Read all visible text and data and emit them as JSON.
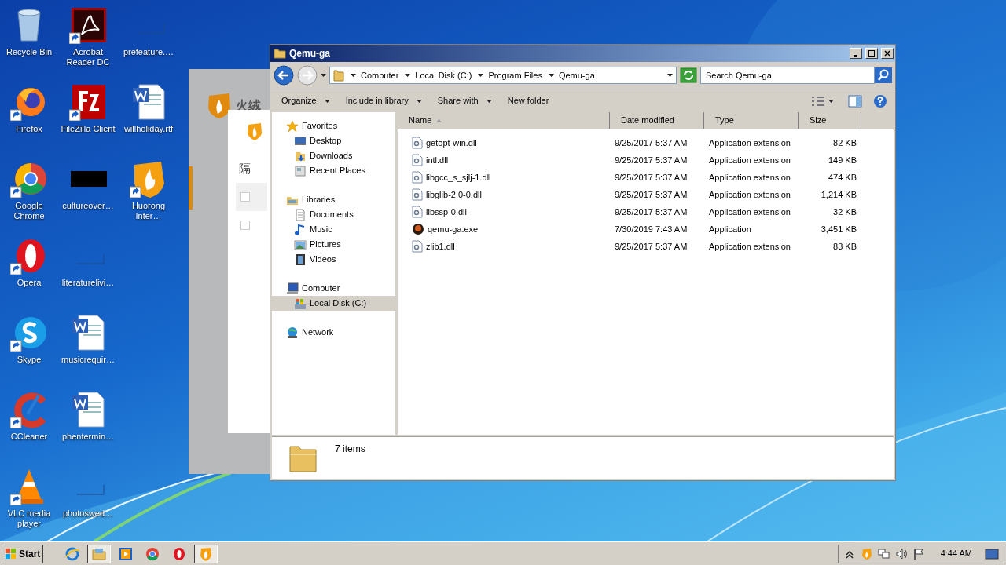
{
  "desktop_icons": [
    {
      "label": "Recycle Bin",
      "kind": "recycle",
      "shortcut": false
    },
    {
      "label": "Firefox",
      "kind": "firefox",
      "shortcut": true
    },
    {
      "label": "Google Chrome",
      "kind": "chrome",
      "shortcut": true
    },
    {
      "label": "Opera",
      "kind": "opera",
      "shortcut": true
    },
    {
      "label": "Skype",
      "kind": "skype",
      "shortcut": true
    },
    {
      "label": "CCleaner",
      "kind": "ccleaner",
      "shortcut": true
    },
    {
      "label": "VLC media player",
      "kind": "vlc",
      "shortcut": true
    },
    {
      "label": "Acrobat Reader DC",
      "kind": "acrobat",
      "shortcut": true
    },
    {
      "label": "FileZilla Client",
      "kind": "filezilla",
      "shortcut": true
    },
    {
      "label": "cultureover…",
      "kind": "black",
      "shortcut": false
    },
    {
      "label": "literaturelivi…",
      "kind": "blank",
      "shortcut": false
    },
    {
      "label": "musicrequir…",
      "kind": "word",
      "shortcut": false
    },
    {
      "label": "phentermin…",
      "kind": "word",
      "shortcut": false
    },
    {
      "label": "photoswed…",
      "kind": "blank",
      "shortcut": false
    },
    {
      "label": "prefeature.…",
      "kind": "blank",
      "shortcut": false
    },
    {
      "label": "willholiday.rtf",
      "kind": "word",
      "shortcut": false
    },
    {
      "label": "Huorong Inter…",
      "kind": "huorong",
      "shortcut": true
    }
  ],
  "background_window": {
    "title": "火绒",
    "heading": "隔",
    "checkboxes": [
      {
        "checked": false
      },
      {
        "checked": false
      }
    ]
  },
  "explorer": {
    "title": "Qemu-ga",
    "breadcrumb": [
      "Computer",
      "Local Disk (C:)",
      "Program Files",
      "Qemu-ga"
    ],
    "search": {
      "placeholder": "Search Qemu-ga"
    },
    "toolbar": [
      {
        "label": "Organize",
        "dropdown": true
      },
      {
        "label": "Include in library",
        "dropdown": true
      },
      {
        "label": "Share with",
        "dropdown": true
      },
      {
        "label": "New folder",
        "dropdown": false
      }
    ],
    "nav": [
      {
        "label": "Favorites",
        "kind": "star",
        "selected": false,
        "children": [
          {
            "label": "Desktop",
            "kind": "desktop",
            "selected": false
          },
          {
            "label": "Downloads",
            "kind": "downloads",
            "selected": false
          },
          {
            "label": "Recent Places",
            "kind": "recent",
            "selected": false
          }
        ]
      },
      {
        "label": "Libraries",
        "kind": "libraries",
        "selected": false,
        "children": [
          {
            "label": "Documents",
            "kind": "documents",
            "selected": false
          },
          {
            "label": "Music",
            "kind": "music",
            "selected": false
          },
          {
            "label": "Pictures",
            "kind": "pictures",
            "selected": false
          },
          {
            "label": "Videos",
            "kind": "videos",
            "selected": false
          }
        ]
      },
      {
        "label": "Computer",
        "kind": "computer",
        "selected": false,
        "children": [
          {
            "label": "Local Disk (C:)",
            "kind": "disk",
            "selected": true
          }
        ]
      },
      {
        "label": "Network",
        "kind": "network",
        "selected": false
      }
    ],
    "columns": [
      {
        "label": "Name",
        "sorted": true
      },
      {
        "label": "Date modified",
        "sorted": false
      },
      {
        "label": "Type",
        "sorted": false
      },
      {
        "label": "Size",
        "sorted": false
      }
    ],
    "rows": [
      {
        "name": "getopt-win.dll",
        "date": "9/25/2017 5:37 AM",
        "type": "Application extension",
        "size": "82 KB",
        "kind": "dll"
      },
      {
        "name": "intl.dll",
        "date": "9/25/2017 5:37 AM",
        "type": "Application extension",
        "size": "149 KB",
        "kind": "dll"
      },
      {
        "name": "libgcc_s_sjlj-1.dll",
        "date": "9/25/2017 5:37 AM",
        "type": "Application extension",
        "size": "474 KB",
        "kind": "dll"
      },
      {
        "name": "libglib-2.0-0.dll",
        "date": "9/25/2017 5:37 AM",
        "type": "Application extension",
        "size": "1,214 KB",
        "kind": "dll"
      },
      {
        "name": "libssp-0.dll",
        "date": "9/25/2017 5:37 AM",
        "type": "Application extension",
        "size": "32 KB",
        "kind": "dll"
      },
      {
        "name": "qemu-ga.exe",
        "date": "7/30/2019 7:43 AM",
        "type": "Application",
        "size": "3,451 KB",
        "kind": "exe"
      },
      {
        "name": "zlib1.dll",
        "date": "9/25/2017 5:37 AM",
        "type": "Application extension",
        "size": "83 KB",
        "kind": "dll"
      }
    ],
    "status": "7 items"
  },
  "taskbar": {
    "start": "Start",
    "apps": [
      {
        "kind": "ie",
        "selected": false
      },
      {
        "kind": "explorer",
        "selected": true
      },
      {
        "kind": "media",
        "selected": false
      },
      {
        "kind": "chrome",
        "selected": false
      },
      {
        "kind": "opera",
        "selected": false
      },
      {
        "kind": "huorong",
        "selected": true
      }
    ],
    "clock": "4:44 AM"
  }
}
